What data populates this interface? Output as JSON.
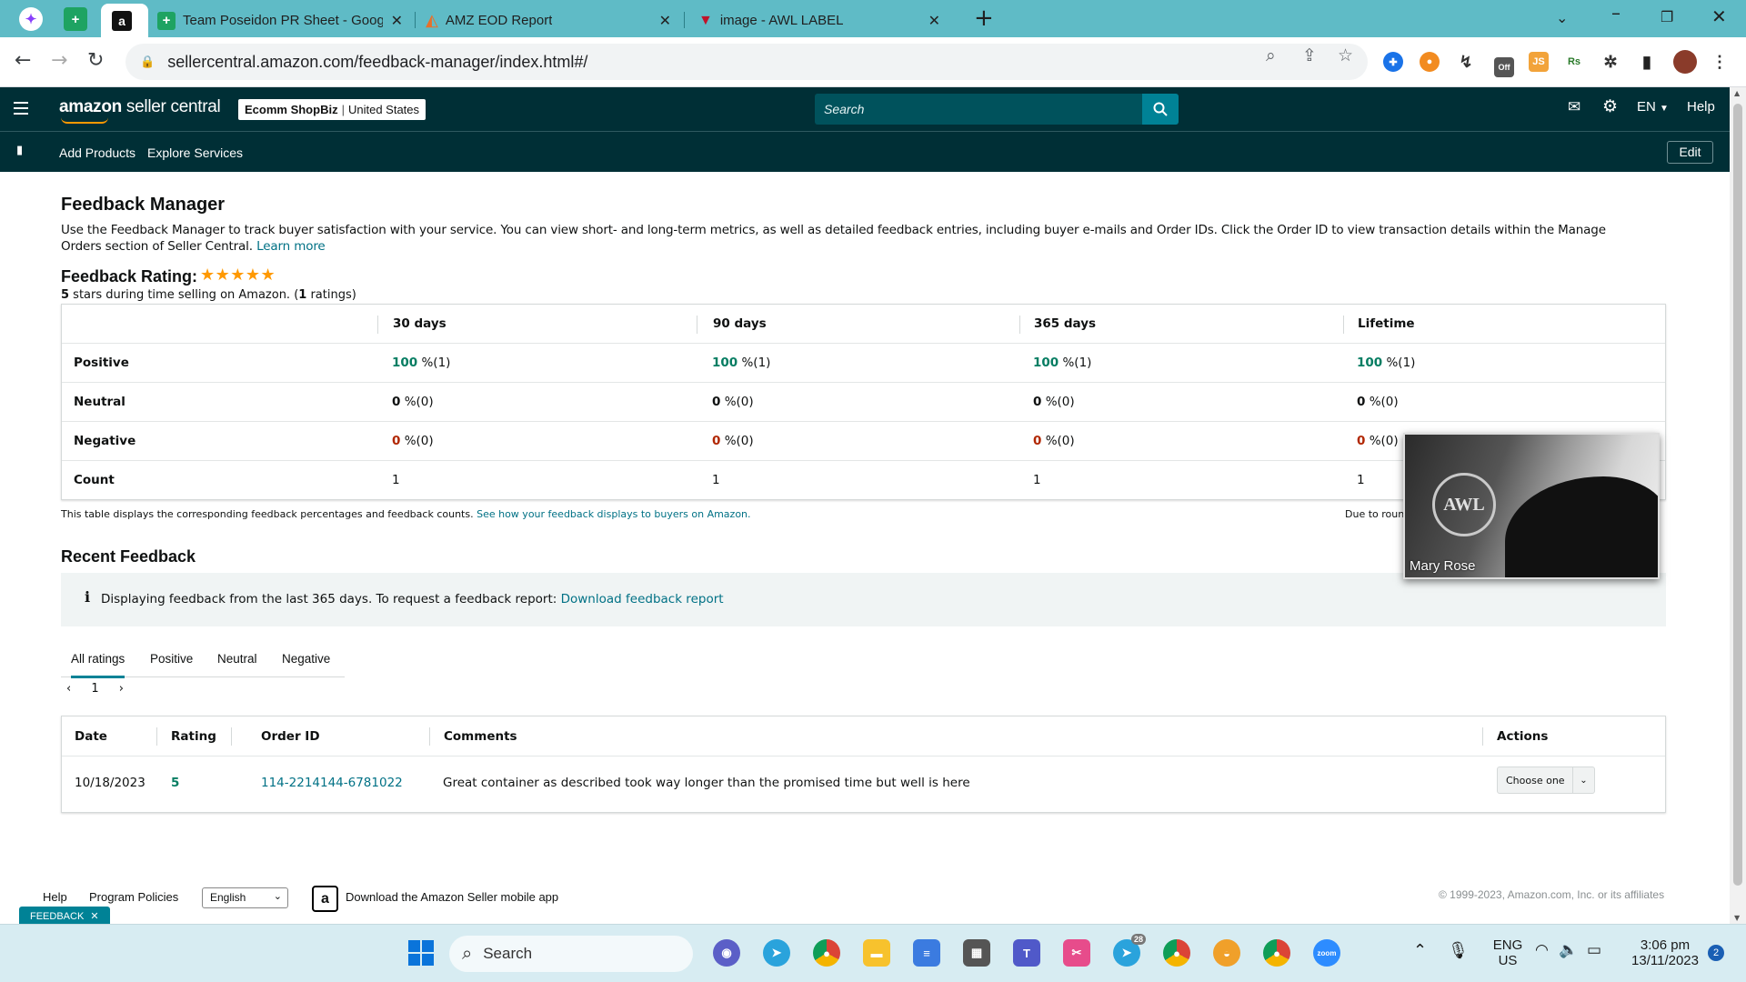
{
  "browser": {
    "tabs": [
      {
        "title": "Team Poseidon PR Sheet - Goog"
      },
      {
        "title": "AMZ EOD Report"
      },
      {
        "title": "image - AWL LABEL"
      }
    ],
    "url": "sellercentral.amazon.com/feedback-manager/index.html#/"
  },
  "header": {
    "logo_bold": "amazon",
    "logo_light": " seller central",
    "store_name": "Ecomm ShopBiz",
    "store_region": "United States",
    "search_placeholder": "Search",
    "language": "EN",
    "help": "Help"
  },
  "subnav": {
    "items": [
      "Add Products",
      "Explore Services"
    ],
    "edit": "Edit"
  },
  "page": {
    "title": "Feedback Manager",
    "intro": "Use the Feedback Manager to track buyer satisfaction with your service. You can view short- and long-term metrics, as well as detailed feedback entries, including buyer e-mails and Order IDs. Click the Order ID to view transaction details within the Manage Orders section of Seller Central.",
    "learn_more": "Learn more",
    "rating_heading": "Feedback Rating:",
    "stars": "★★★★★",
    "rating_value": "5",
    "rating_text_a": " stars during time selling on Amazon. (",
    "rating_count": "1",
    "rating_text_b": " ratings)"
  },
  "metrics": {
    "columns": [
      "30 days",
      "90 days",
      "365 days",
      "Lifetime"
    ],
    "rows": {
      "positive": {
        "label": "Positive",
        "value": "100",
        "suffix": " %(1)"
      },
      "neutral": {
        "label": "Neutral",
        "value": "0",
        "suffix": " %(0)"
      },
      "negative": {
        "label": "Negative",
        "value": "0",
        "suffix": " %(0)"
      },
      "count": {
        "label": "Count",
        "value": "1"
      }
    },
    "note": "This table displays the corresponding feedback percentages and feedback counts.",
    "note_link": "See how your feedback displays to buyers on Amazon.",
    "due_note": "Due to roun"
  },
  "recent": {
    "title": "Recent Feedback",
    "info_text": "Displaying feedback from the last 365 days. To request a feedback report:",
    "info_link": "Download feedback report",
    "tabs": [
      "All ratings",
      "Positive",
      "Neutral",
      "Negative"
    ],
    "page": "1",
    "columns": {
      "date": "Date",
      "rating": "Rating",
      "order_id": "Order ID",
      "comments": "Comments",
      "actions": "Actions"
    },
    "row": {
      "date": "10/18/2023",
      "rating": "5",
      "order_id": "114-2214144-6781022",
      "comment": "Great container as described took way longer than the promised time but well is here",
      "action": "Choose one"
    }
  },
  "video": {
    "name": "Mary Rose"
  },
  "footer": {
    "help": "Help",
    "program_policies": "Program Policies",
    "language": "English",
    "app_text": "Download the Amazon Seller mobile app",
    "copyright": "© 1999-2023, Amazon.com, Inc. or its affiliates",
    "feedback_tab": "FEEDBACK"
  },
  "taskbar": {
    "search": "Search",
    "lang_top": "ENG",
    "lang_bottom": "US",
    "time": "3:06 pm",
    "date": "13/11/2023",
    "notification_count": "2",
    "telegram_badge": "28"
  },
  "colors": {
    "header_bg": "#002f36",
    "accent": "#008296",
    "positive": "#067d62",
    "negative": "#b12704",
    "star": "#ff9900"
  }
}
